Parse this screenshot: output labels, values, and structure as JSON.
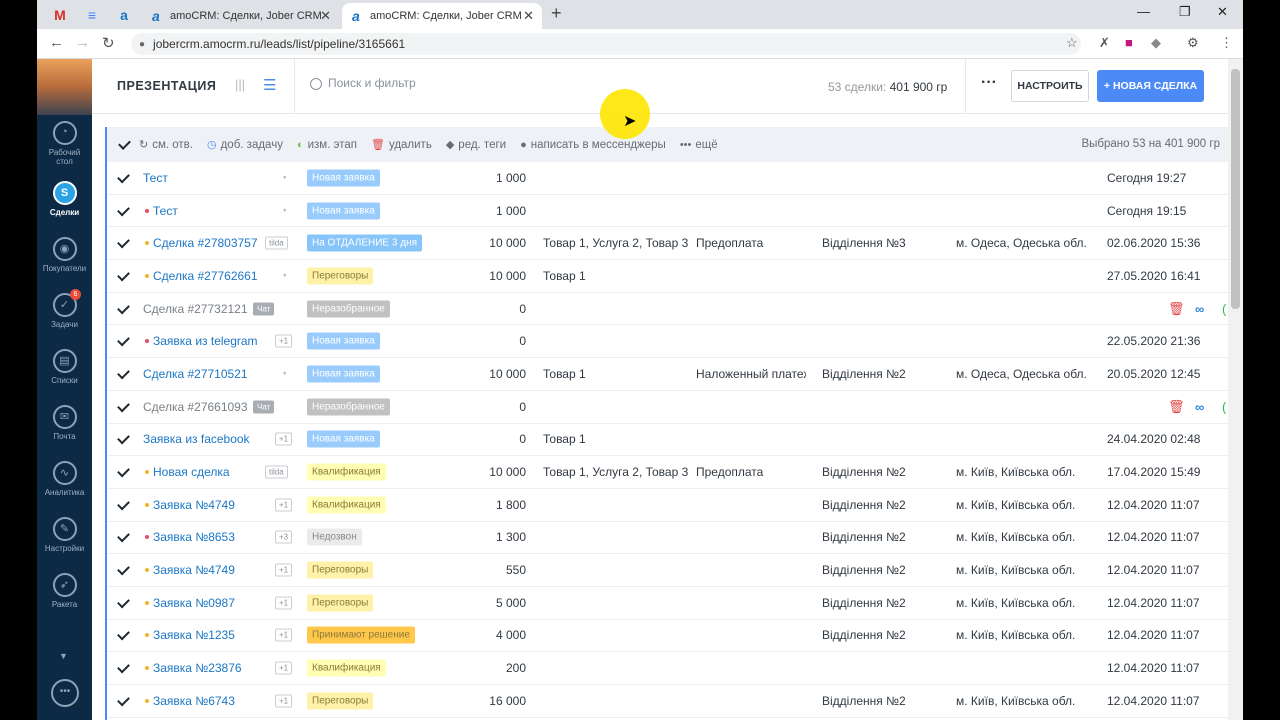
{
  "browser": {
    "pinned": [
      {
        "glyph": "M",
        "color": "#d93025"
      },
      {
        "glyph": "≡",
        "color": "#4285f4"
      },
      {
        "glyph": "a",
        "color": "#1876c8"
      }
    ],
    "tabs": [
      {
        "title": "amoCRM: Сделки, Jober CRM",
        "active": false
      },
      {
        "title": "amoCRM: Сделки, Jober CRM",
        "active": true
      }
    ],
    "url": "jobercrm.amocrm.ru/leads/list/pipeline/3165661"
  },
  "sidebar": {
    "items": [
      {
        "label": "Рабочий\nстол",
        "active": false,
        "badge": ""
      },
      {
        "label": "Сделки",
        "active": true,
        "badge": ""
      },
      {
        "label": "Покупатели",
        "active": false,
        "badge": ""
      },
      {
        "label": "Задачи",
        "active": false,
        "badge": "6"
      },
      {
        "label": "Списки",
        "active": false,
        "badge": ""
      },
      {
        "label": "Почта",
        "active": false,
        "badge": ""
      },
      {
        "label": "Аналитика",
        "active": false,
        "badge": ""
      },
      {
        "label": "Настройки",
        "active": false,
        "badge": ""
      },
      {
        "label": "Ракета",
        "active": false,
        "badge": ""
      }
    ]
  },
  "topbar": {
    "pipeline": "ПРЕЗЕНТАЦИЯ",
    "search_placeholder": "Поиск и фильтр",
    "summary_count": "53 сделки:",
    "summary_sum": "401 900 гр",
    "settings_label": "НАСТРОИТЬ",
    "new_label": "+ НОВАЯ СДЕЛКА"
  },
  "actionbar": {
    "actions": [
      "см. отв.",
      "доб. задачу",
      "изм. этап",
      "удалить",
      "ред. теги",
      "написать в мессенджеры",
      "ещё"
    ],
    "selected": "Выбрано 53 на 401 900 гр"
  },
  "colors": {
    "new": "#99ccfd",
    "transfer": "#87c4fa",
    "negotiation": "#fff1a8",
    "unsorted": "#c1c1c1",
    "qualification": "#fffeb2",
    "nocall": "#ebebeb",
    "decision": "#ffc84b"
  },
  "rows": [
    {
      "name": "Тест",
      "dot": "",
      "tag": "•",
      "tagtype": "dotonly",
      "status": "Новая заявка",
      "sclass": "new",
      "budget": "1 000",
      "products": "",
      "payment": "",
      "branch": "",
      "city": "",
      "date": "Сегодня 19:27",
      "unsorted": false
    },
    {
      "name": "Тест",
      "dot": "#e94b6a",
      "tag": "•",
      "tagtype": "dotonly",
      "status": "Новая заявка",
      "sclass": "new",
      "budget": "1 000",
      "products": "",
      "payment": "",
      "branch": "",
      "city": "",
      "date": "Сегодня 19:15",
      "unsorted": false
    },
    {
      "name": "Сделка #27803757",
      "dot": "#f0b429",
      "tag": "tilda",
      "tagtype": "tag",
      "status": "На ОТДАЛЕНИЕ 3 дня",
      "sclass": "transfer",
      "budget": "10 000",
      "products": "Товар 1, Услуга 2, Товар 3",
      "payment": "Предоплата",
      "branch": "Відділення №3",
      "city": "м. Одеса, Одеська обл.",
      "date": "02.06.2020 15:36",
      "unsorted": false
    },
    {
      "name": "Сделка #27762661",
      "dot": "#f0b429",
      "tag": "•",
      "tagtype": "dotonly",
      "status": "Переговоры",
      "sclass": "negotiation",
      "budget": "10 000",
      "products": "Товар 1",
      "payment": "",
      "branch": "",
      "city": "",
      "date": "27.05.2020 16:41",
      "unsorted": false
    },
    {
      "name": "Сделка #27732121",
      "dot": "",
      "tag": "Чат",
      "tagtype": "chat",
      "status": "Неразобранное",
      "sclass": "unsorted",
      "budget": "0",
      "products": "",
      "payment": "",
      "branch": "",
      "city": "",
      "date": "",
      "unsorted": true
    },
    {
      "name": "Заявка из telegram",
      "dot": "#e94b6a",
      "tag": "+1",
      "tagtype": "plus",
      "status": "Новая заявка",
      "sclass": "new",
      "budget": "0",
      "products": "",
      "payment": "",
      "branch": "",
      "city": "",
      "date": "22.05.2020 21:36",
      "unsorted": false
    },
    {
      "name": "Сделка #27710521",
      "dot": "",
      "tag": "•",
      "tagtype": "dotonly",
      "status": "Новая заявка",
      "sclass": "new",
      "budget": "10 000",
      "products": "Товар 1",
      "payment": "Наложенный платеж",
      "branch": "Відділення №2",
      "city": "м. Одеса, Одеська обл.",
      "date": "20.05.2020 12:45",
      "unsorted": false
    },
    {
      "name": "Сделка #27661093",
      "dot": "",
      "tag": "Чат",
      "tagtype": "chat",
      "status": "Неразобранное",
      "sclass": "unsorted",
      "budget": "0",
      "products": "",
      "payment": "",
      "branch": "",
      "city": "",
      "date": "",
      "unsorted": true
    },
    {
      "name": "Заявка из facebook",
      "dot": "",
      "tag": "+1",
      "tagtype": "plus",
      "status": "Новая заявка",
      "sclass": "new",
      "budget": "0",
      "products": "Товар 1",
      "payment": "",
      "branch": "",
      "city": "",
      "date": "24.04.2020 02:48",
      "unsorted": false
    },
    {
      "name": "Новая сделка",
      "dot": "#f0b429",
      "tag": "tilda",
      "tagtype": "tag",
      "status": "Квалификация",
      "sclass": "qualification",
      "budget": "10 000",
      "products": "Товар 1, Услуга 2, Товар 3",
      "payment": "Предоплата",
      "branch": "Відділення №2",
      "city": "м. Київ, Київська обл.",
      "date": "17.04.2020 15:49",
      "unsorted": false
    },
    {
      "name": "Заявка №4749",
      "dot": "#f0b429",
      "tag": "+1",
      "tagtype": "plus",
      "status": "Квалификация",
      "sclass": "qualification",
      "budget": "1 800",
      "products": "",
      "payment": "",
      "branch": "Відділення №2",
      "city": "м. Київ, Київська обл.",
      "date": "12.04.2020 11:07",
      "unsorted": false
    },
    {
      "name": "Заявка №8653",
      "dot": "#e94b6a",
      "tag": "+3",
      "tagtype": "plus",
      "status": "Недозвон",
      "sclass": "nocall",
      "budget": "1 300",
      "products": "",
      "payment": "",
      "branch": "Відділення №2",
      "city": "м. Київ, Київська обл.",
      "date": "12.04.2020 11:07",
      "unsorted": false
    },
    {
      "name": "Заявка №4749",
      "dot": "#f0b429",
      "tag": "+1",
      "tagtype": "plus",
      "status": "Переговоры",
      "sclass": "negotiation",
      "budget": "550",
      "products": "",
      "payment": "",
      "branch": "Відділення №2",
      "city": "м. Київ, Київська обл.",
      "date": "12.04.2020 11:07",
      "unsorted": false
    },
    {
      "name": "Заявка №0987",
      "dot": "#f0b429",
      "tag": "+1",
      "tagtype": "plus",
      "status": "Переговоры",
      "sclass": "negotiation",
      "budget": "5 000",
      "products": "",
      "payment": "",
      "branch": "Відділення №2",
      "city": "м. Київ, Київська обл.",
      "date": "12.04.2020 11:07",
      "unsorted": false
    },
    {
      "name": "Заявка №1235",
      "dot": "#f0b429",
      "tag": "+1",
      "tagtype": "plus",
      "status": "Принимают решение",
      "sclass": "decision",
      "budget": "4 000",
      "products": "",
      "payment": "",
      "branch": "Відділення №2",
      "city": "м. Київ, Київська обл.",
      "date": "12.04.2020 11:07",
      "unsorted": false
    },
    {
      "name": "Заявка №23876",
      "dot": "#f0b429",
      "tag": "+1",
      "tagtype": "plus",
      "status": "Квалификация",
      "sclass": "qualification",
      "budget": "200",
      "products": "",
      "payment": "",
      "branch": "",
      "city": "",
      "date": "12.04.2020 11:07",
      "unsorted": false
    },
    {
      "name": "Заявка №6743",
      "dot": "#f0b429",
      "tag": "+1",
      "tagtype": "plus",
      "status": "Переговоры",
      "sclass": "negotiation",
      "budget": "16 000",
      "products": "",
      "payment": "",
      "branch": "Відділення №2",
      "city": "м. Київ, Київська обл.",
      "date": "12.04.2020 11:07",
      "unsorted": false
    }
  ]
}
